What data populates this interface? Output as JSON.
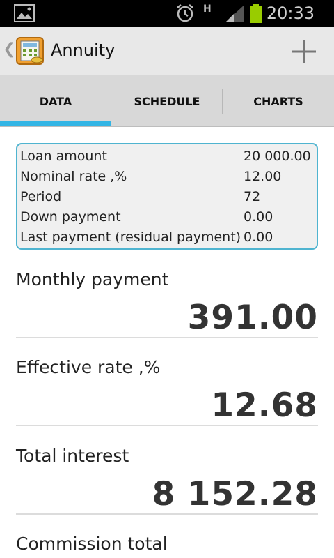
{
  "status_bar": {
    "time": "20:33",
    "network": "H"
  },
  "action_bar": {
    "title": "Annuity"
  },
  "tabs": [
    {
      "label": "DATA",
      "active": true
    },
    {
      "label": "SCHEDULE",
      "active": false
    },
    {
      "label": "CHARTS",
      "active": false
    }
  ],
  "inputs": [
    {
      "label": "Loan amount",
      "value": "20 000.00"
    },
    {
      "label": "Nominal rate ,%",
      "value": "12.00"
    },
    {
      "label": "Period",
      "value": "72"
    },
    {
      "label": "Down payment",
      "value": "0.00"
    },
    {
      "label": "Last payment (residual payment)",
      "value": "0.00"
    }
  ],
  "results": [
    {
      "label": "Monthly payment",
      "value": "391.00"
    },
    {
      "label": "Effective rate ,%",
      "value": "12.68"
    },
    {
      "label": "Total interest",
      "value": "8 152.28"
    },
    {
      "label": "Commission total",
      "value": ""
    }
  ],
  "colors": {
    "accent": "#33b5e5",
    "box_border": "#4fb4d0",
    "battery": "#99cc00"
  },
  "icons": [
    "gallery-icon",
    "alarm-icon",
    "signal-icon",
    "battery-icon",
    "back-chevron-icon",
    "calculator-app-icon",
    "add-icon"
  ]
}
